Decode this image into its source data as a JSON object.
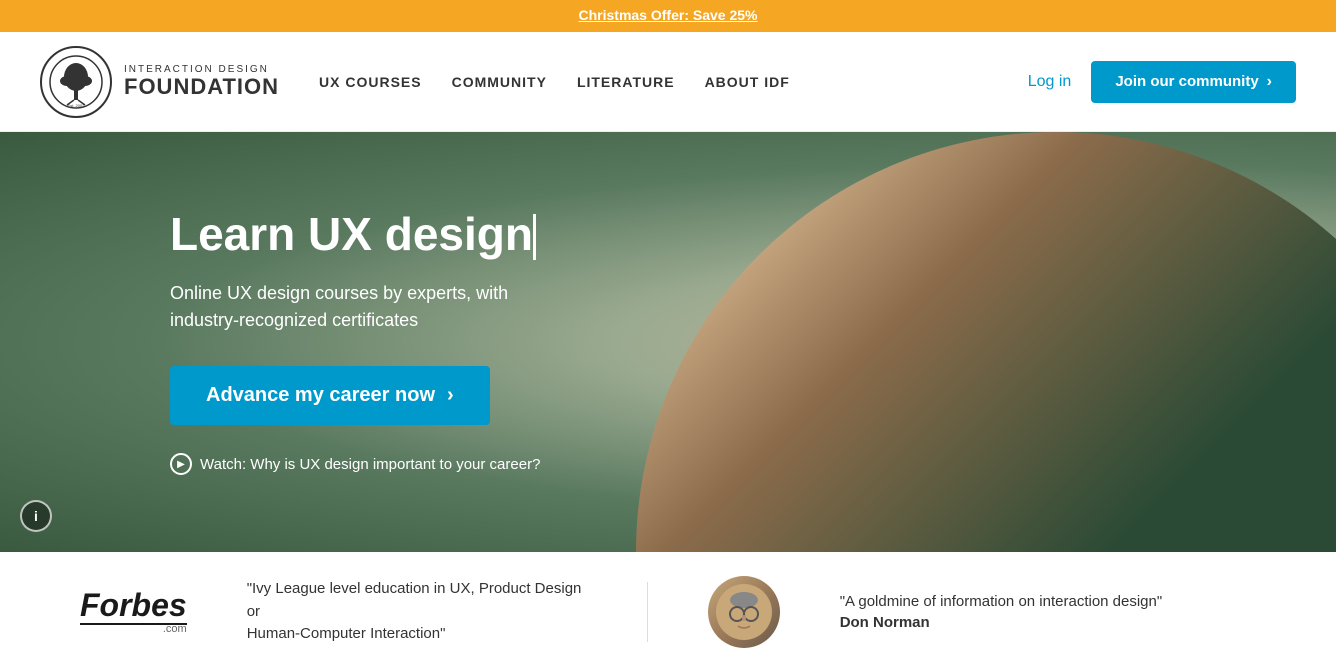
{
  "banner": {
    "text": "Christmas Offer: Save 25%"
  },
  "header": {
    "logo": {
      "top_line": "INTERACTION DESIGN",
      "bottom_line": "FOUNDATION"
    },
    "nav": {
      "items": [
        {
          "label": "UX COURSES",
          "id": "ux-courses"
        },
        {
          "label": "COMMUNITY",
          "id": "community"
        },
        {
          "label": "LITERATURE",
          "id": "literature"
        },
        {
          "label": "ABOUT IDF",
          "id": "about-idf"
        }
      ]
    },
    "actions": {
      "login_label": "Log in",
      "join_label": "Join our community"
    }
  },
  "hero": {
    "title": "Learn UX design",
    "subtitle": "Online UX design courses by experts, with\nindustry-recognized certificates",
    "cta_label": "Advance my career now",
    "watch_label": "Watch: Why is UX design important to your career?"
  },
  "testimonials": {
    "forbes": {
      "logo": "Forbes",
      "com": ".com",
      "quote": "\"Ivy League level education in UX, Product Design or\nHuman-Computer Interaction\""
    },
    "don_norman": {
      "quote": "\"A goldmine of information on interaction design\"",
      "name": "Don Norman"
    }
  },
  "colors": {
    "orange": "#f5a623",
    "blue": "#0099cc",
    "dark": "#333333",
    "white": "#ffffff"
  }
}
